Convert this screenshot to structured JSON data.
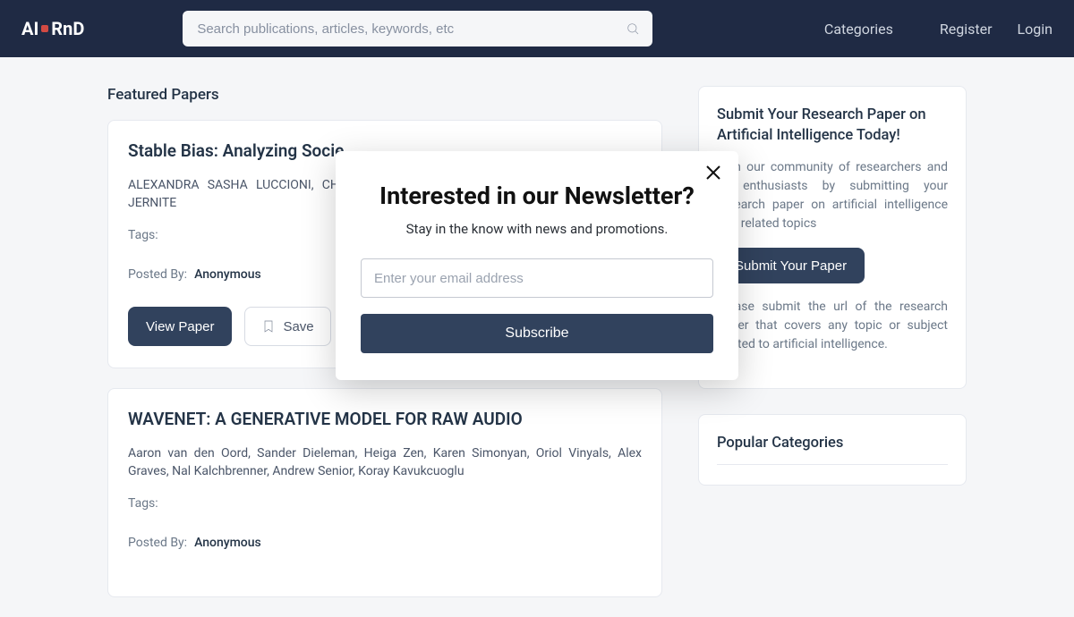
{
  "brand": {
    "part1": "AI",
    "part2": "RnD"
  },
  "search": {
    "placeholder": "Search publications, articles, keywords, etc"
  },
  "nav": {
    "categories": "Categories",
    "register": "Register",
    "login": "Login"
  },
  "section_featured": "Featured Papers",
  "papers": [
    {
      "title": "Stable Bias: Analyzing Socie",
      "authors": "ALEXANDRA SASHA LUCCIONI, CHRISTOPHER AKIKI, MARGARET MITCHELL, YACINE JERNITE",
      "tags_label": "Tags:",
      "postedby_label": "Posted By:",
      "postedby_value": "Anonymous",
      "view": "View Paper",
      "save": "Save"
    },
    {
      "title": "WAVENET: A GENERATIVE MODEL FOR RAW AUDIO",
      "authors": "Aaron van den Oord, Sander Dieleman, Heiga Zen, Karen Simonyan, Oriol Vinyals, Alex Graves, Nal Kalchbrenner, Andrew Senior, Koray Kavukcuoglu",
      "tags_label": "Tags:",
      "postedby_label": "Posted By:",
      "postedby_value": "Anonymous"
    }
  ],
  "sidebar": {
    "submit_title": "Submit Your Research Paper on Artificial Intelligence Today!",
    "submit_body1": "Join our community of researchers and AI enthusiasts by submitting your research paper on artificial intelligence and related topics",
    "submit_cta": "Submit Your Paper",
    "submit_body2": "Please submit the url of the research paper that covers any topic or subject related to artificial intelligence.",
    "popular_title": "Popular Categories"
  },
  "modal": {
    "title": "Interested in our Newsletter?",
    "subtitle": "Stay in the know with news and promotions.",
    "email_placeholder": "Enter your email address",
    "cta": "Subscribe"
  }
}
